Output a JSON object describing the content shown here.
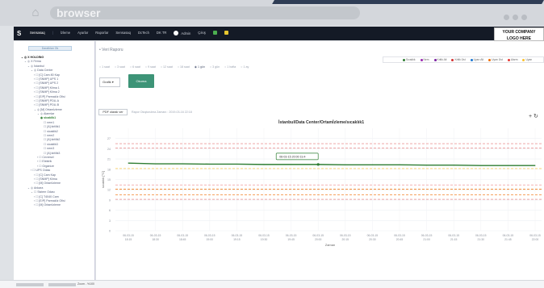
{
  "browser": {
    "url_label": "browser"
  },
  "appbar": {
    "brand_glyph": "S",
    "items": [
      "Sensasaq",
      "|",
      "İzleme",
      "Ayarlar",
      "Raporlar",
      "Sensasaq",
      "DcTech",
      "DK TR"
    ],
    "user": "Admin",
    "logout": "Çıkış"
  },
  "logo": {
    "line1": "YOUR COMPANY",
    "line2": "LOGO HERE"
  },
  "sidebar": {
    "search_label": "Daraltılan Ok",
    "tree": [
      {
        "text": "⌄ ◎ X HOLDİNG",
        "indent": 9,
        "style": "bold"
      },
      {
        "text": "⌄ ◎ X Firma",
        "indent": 13
      },
      {
        "text": "⌄ ◎ İstanbul",
        "indent": 17
      },
      {
        "text": "⌄ ◎ Data Center",
        "indent": 21
      },
      {
        "text": "› ☐ [C] Cam 80 Kap",
        "indent": 25
      },
      {
        "text": "› ☐ [SNMP] UPS 1",
        "indent": 25
      },
      {
        "text": "› ☐ [SNMP] UPS 2",
        "indent": 25
      },
      {
        "text": "› ☐ [SNMP] Klima 1",
        "indent": 25
      },
      {
        "text": "› ☐ [SNMP] Klima 2",
        "indent": 25
      },
      {
        "text": "› ☐ [E/P] Parmakİz Ofisi",
        "indent": 25
      },
      {
        "text": "› ☐ [SNMP] PDU-A",
        "indent": 25
      },
      {
        "text": "› ☐ [SNMP] PDU-B",
        "indent": 25
      },
      {
        "text": "⌄ ◎ [M] Ortamİzleme",
        "indent": 25
      },
      {
        "text": "⌄ ◎ Alarmlar",
        "indent": 29
      },
      {
        "text": "◉ sicaklik1",
        "indent": 33,
        "style": "sel"
      },
      {
        "text": "☐ nem1",
        "indent": 37
      },
      {
        "text": "☐ [A] kirlilik1",
        "indent": 37
      },
      {
        "text": "☐ sicaklik2",
        "indent": 37
      },
      {
        "text": "☐ nem2",
        "indent": 37
      },
      {
        "text": "☐ [A] kirlilik2",
        "indent": 37
      },
      {
        "text": "☐ sicaklik3",
        "indent": 37
      },
      {
        "text": "☐ nem3",
        "indent": 37
      },
      {
        "text": "☐ [A] kirlilik3",
        "indent": 37
      },
      {
        "text": "› ☐ Cevresel",
        "indent": 29
      },
      {
        "text": "› ☐ Elektrik",
        "indent": 29
      },
      {
        "text": "› ☐ Organize",
        "indent": 29
      },
      {
        "text": "› ☐ UPS Odası",
        "indent": 21
      },
      {
        "text": "› ☐ [C] Cam Kap",
        "indent": 25
      },
      {
        "text": "› ☐ [SNMP] Klima",
        "indent": 25
      },
      {
        "text": "› ☐ [M] Ortamİzleme",
        "indent": 25
      },
      {
        "text": "⌄ ◎ Ankara",
        "indent": 17
      },
      {
        "text": "⌄ ☐ Sistem Odası",
        "indent": 21
      },
      {
        "text": "› ☐ [C] T4040 Cam",
        "indent": 25
      },
      {
        "text": "› ☐ [E/P] Parmakİz Ofisi",
        "indent": 25
      },
      {
        "text": "› ☐ [M] Ortamİzleme",
        "indent": 25
      }
    ]
  },
  "main": {
    "title": "• Veri Raporu",
    "range_chips": [
      "1 saat",
      "3 saat",
      "6 saat",
      "9 saat",
      "12 saat",
      "18 saat",
      "1 gün",
      "3 gün",
      "1 hafta",
      "1 ay"
    ],
    "active_chip": 6,
    "select_value": "Grafik",
    "ok_button": "Okuma",
    "pdf_button": "PDF olarak ver",
    "created_text": "Rapor Oluşturulma Zamanı : 2019-03-16 22:18",
    "legend": [
      {
        "name": "Sıcaklık",
        "color": "#2e7d32"
      },
      {
        "name": "Nem",
        "color": "#9c27b0"
      },
      {
        "name": "Kritik Alt",
        "color": "#7b1fa2"
      },
      {
        "name": "Kritik Üst",
        "color": "#d32f2f"
      },
      {
        "name": "Uyarı Alt",
        "color": "#1976d2"
      },
      {
        "name": "Uyarı Üst",
        "color": "#ef6c00"
      },
      {
        "name": "Alarm",
        "color": "#e53935"
      },
      {
        "name": "Uyarı",
        "color": "#fbc02d"
      }
    ]
  },
  "chart_data": {
    "type": "line",
    "title": "İstanbul/Data Center/Ortamİzleme/sıcaklık1",
    "xlabel": "Zaman",
    "ylabel": "sıcaklık [°C]",
    "ylim": [
      0,
      30
    ],
    "yticks": [
      0,
      3,
      6,
      9,
      12,
      15,
      18,
      21,
      24,
      27
    ],
    "x": [
      "06-03-15 18:15",
      "06-03-15 18:30",
      "06-03-15 18:45",
      "06-03-15 19:00",
      "06-03-15 19:15",
      "06-03-15 19:30",
      "06-03-15 19:45",
      "06-03-15 20:00",
      "06-03-15 20:15",
      "06-03-15 20:30",
      "06-03-15 20:45",
      "06-03-15 21:00",
      "06-03-15 21:15",
      "06-03-15 21:30",
      "06-03-15 21:45",
      "06-03-15 22:00"
    ],
    "series": [
      {
        "name": "sıcaklık1",
        "color": "#2e7d32",
        "values": [
          19.8,
          19.6,
          19.6,
          19.5,
          19.5,
          19.4,
          19.4,
          19.4,
          19.3,
          19.3,
          19.3,
          19.2,
          19.2,
          19.1,
          19.1,
          19.1
        ]
      }
    ],
    "thresholds": [
      {
        "value": 25.5,
        "color": "#e57373"
      },
      {
        "value": 24.2,
        "color": "#e57373"
      },
      {
        "value": 18.2,
        "color": "#fbc02d"
      },
      {
        "value": 13.4,
        "color": "#ef9a9a"
      },
      {
        "value": 12.2,
        "color": "#ef6c00"
      },
      {
        "value": 10.5,
        "color": "#ef6c00"
      },
      {
        "value": 9.2,
        "color": "#e57373"
      }
    ],
    "tooltip": {
      "x": "06-03-15 20:00",
      "value": "19.4"
    },
    "grid": true
  },
  "status": {
    "text": "Zoom - %100"
  }
}
